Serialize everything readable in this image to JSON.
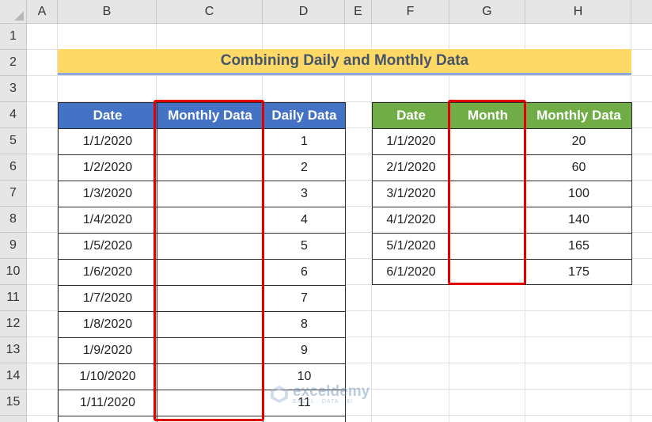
{
  "columns": [
    "A",
    "B",
    "C",
    "D",
    "E",
    "F",
    "G",
    "H"
  ],
  "rows": [
    "1",
    "2",
    "3",
    "4",
    "5",
    "6",
    "7",
    "8",
    "9",
    "10",
    "11",
    "12",
    "13",
    "14",
    "15"
  ],
  "title": "Combining Daily and Monthly Data",
  "daily_table": {
    "headers": [
      "Date",
      "Monthly Data",
      "Daily Data"
    ],
    "rows": [
      {
        "date": "1/1/2020",
        "monthly": "",
        "daily": "1"
      },
      {
        "date": "1/2/2020",
        "monthly": "",
        "daily": "2"
      },
      {
        "date": "1/3/2020",
        "monthly": "",
        "daily": "3"
      },
      {
        "date": "1/4/2020",
        "monthly": "",
        "daily": "4"
      },
      {
        "date": "1/5/2020",
        "monthly": "",
        "daily": "5"
      },
      {
        "date": "1/6/2020",
        "monthly": "",
        "daily": "6"
      },
      {
        "date": "1/7/2020",
        "monthly": "",
        "daily": "7"
      },
      {
        "date": "1/8/2020",
        "monthly": "",
        "daily": "8"
      },
      {
        "date": "1/9/2020",
        "monthly": "",
        "daily": "9"
      },
      {
        "date": "1/10/2020",
        "monthly": "",
        "daily": "10"
      },
      {
        "date": "1/11/2020",
        "monthly": "",
        "daily": "11"
      }
    ]
  },
  "monthly_table": {
    "headers": [
      "Date",
      "Month",
      "Monthly Data"
    ],
    "rows": [
      {
        "date": "1/1/2020",
        "month": "",
        "value": "20"
      },
      {
        "date": "2/1/2020",
        "month": "",
        "value": "60"
      },
      {
        "date": "3/1/2020",
        "month": "",
        "value": "100"
      },
      {
        "date": "4/1/2020",
        "month": "",
        "value": "140"
      },
      {
        "date": "5/1/2020",
        "month": "",
        "value": "165"
      },
      {
        "date": "6/1/2020",
        "month": "",
        "value": "175"
      }
    ]
  },
  "watermark": {
    "name": "exceldemy",
    "tagline": "EXCEL · DATA · BI"
  },
  "colors": {
    "header_blue": "#4472c4",
    "header_green": "#70ad47",
    "title_fill": "#ffd966",
    "highlight": "#e00000"
  }
}
